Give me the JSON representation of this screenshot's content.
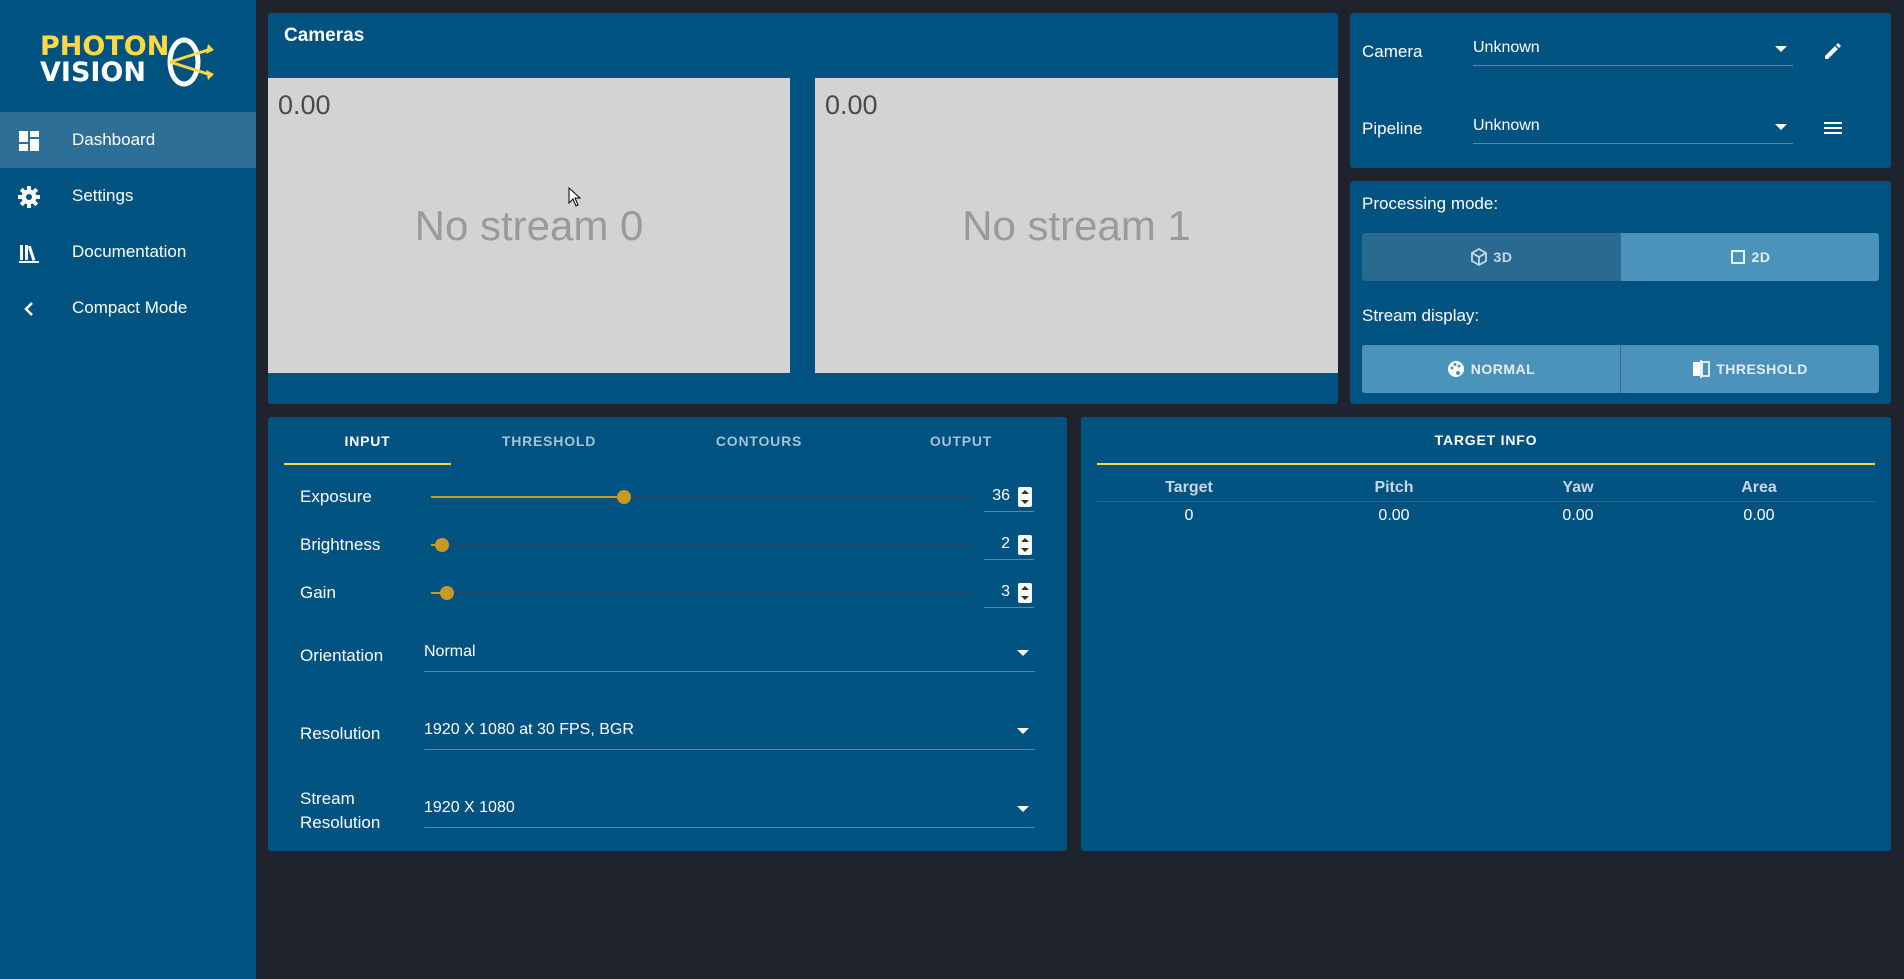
{
  "sidebar": {
    "logo_line1": "PHOTON",
    "logo_line2": "VISION",
    "items": [
      {
        "label": "Dashboard",
        "icon": "dashboard-icon",
        "active": true
      },
      {
        "label": "Settings",
        "icon": "gear-icon"
      },
      {
        "label": "Documentation",
        "icon": "books-icon"
      },
      {
        "label": "Compact Mode",
        "icon": "chevron-left-icon"
      }
    ]
  },
  "cameras": {
    "title": "Cameras",
    "streams": [
      {
        "fps": "0.00",
        "message": "No stream 0"
      },
      {
        "fps": "0.00",
        "message": "No stream 1"
      }
    ]
  },
  "selectors": {
    "camera_label": "Camera",
    "camera_value": "Unknown",
    "pipeline_label": "Pipeline",
    "pipeline_value": "Unknown"
  },
  "modes": {
    "processing_label": "Processing mode:",
    "processing_options": [
      "3D",
      "2D"
    ],
    "processing_selected": "2D",
    "stream_label": "Stream display:",
    "stream_options": [
      "NORMAL",
      "THRESHOLD"
    ]
  },
  "input": {
    "tabs": [
      "INPUT",
      "THRESHOLD",
      "CONTOURS",
      "OUTPUT"
    ],
    "active_tab": "INPUT",
    "exposure": {
      "label": "Exposure",
      "value": "36",
      "fraction": 0.36
    },
    "brightness": {
      "label": "Brightness",
      "value": "2",
      "fraction": 0.02
    },
    "gain": {
      "label": "Gain",
      "value": "3",
      "fraction": 0.03
    },
    "orientation": {
      "label": "Orientation",
      "value": "Normal"
    },
    "resolution": {
      "label": "Resolution",
      "value": "1920 X 1080 at 30 FPS, BGR"
    },
    "stream_resolution": {
      "label_line1": "Stream",
      "label_line2": "Resolution",
      "value": "1920 X 1080"
    }
  },
  "target_info": {
    "title": "TARGET INFO",
    "headers": [
      "Target",
      "Pitch",
      "Yaw",
      "Area"
    ],
    "row": [
      "0",
      "0.00",
      "0.00",
      "0.00"
    ]
  },
  "colors": {
    "panel": "#005281",
    "accent": "#ffd843",
    "slider": "#c79a20",
    "background": "#1f232e"
  }
}
